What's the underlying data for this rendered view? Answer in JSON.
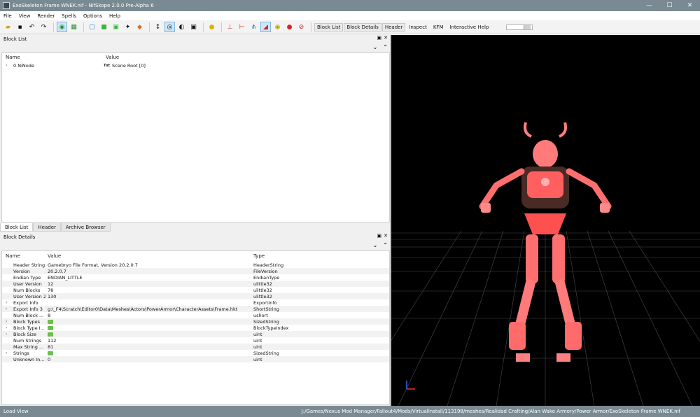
{
  "window": {
    "title": "ExoSkeleton Frame WNEK.nif - NifSkope 2.0.0 Pre-Alpha 6",
    "minimize": "—",
    "maximize": "☐",
    "close": "✕"
  },
  "menu": [
    "File",
    "View",
    "Render",
    "Spells",
    "Options",
    "Help"
  ],
  "toolbar": {
    "buttons": [
      "Block List",
      "Block Details",
      "Header",
      "Inspect",
      "KFM",
      "Interactive Help"
    ]
  },
  "block_list": {
    "title": "Block List",
    "columns": [
      "Name",
      "Value"
    ],
    "rows": [
      {
        "name": "0 NiNode",
        "value": "Scene Root [0]",
        "value_icon": "Txt"
      }
    ]
  },
  "tabs": [
    "Block List",
    "Header",
    "Archive Browser"
  ],
  "block_details": {
    "title": "Block Details",
    "columns": [
      "Name",
      "Value",
      "Type"
    ],
    "rows": [
      {
        "name": "Header String",
        "value": "Gamebryo File Format, Version 20.2.0.7",
        "type": "HeaderString"
      },
      {
        "name": "Version",
        "value": "20.2.0.7",
        "type": "FileVersion"
      },
      {
        "name": "Endian Type",
        "value": "ENDIAN_LITTLE",
        "type": "EndianType"
      },
      {
        "name": "User Version",
        "value": "12",
        "type": "ulittle32"
      },
      {
        "name": "Num Blocks",
        "value": "78",
        "type": "ulittle32"
      },
      {
        "name": "User Version 2",
        "value": "130",
        "type": "ulittle32"
      },
      {
        "name": "Export Info",
        "value": "",
        "type": "ExportInfo"
      },
      {
        "name": "Export Info 3",
        "value": "g:\\_F4\\Scratch\\Editor0\\Data\\Meshes\\Actors\\PowerArmor\\CharacterAssets\\Frame.hkt",
        "type": "ShortString"
      },
      {
        "name": "Num Block ...",
        "value": "8",
        "type": "ushort"
      },
      {
        "name": "Block Types",
        "value": "",
        "type": "SizedString"
      },
      {
        "name": "Block Type I...",
        "value": "",
        "type": "BlockTypeIndex"
      },
      {
        "name": "Block Size",
        "value": "",
        "type": "uint"
      },
      {
        "name": "Num Strings",
        "value": "112",
        "type": "uint"
      },
      {
        "name": "Max String ...",
        "value": "81",
        "type": "uint"
      },
      {
        "name": "Strings",
        "value": "",
        "type": "SizedString"
      },
      {
        "name": "Unknown In...",
        "value": "0",
        "type": "uint"
      }
    ]
  },
  "status": {
    "left": "Load View",
    "path": "J:/Games/Nexus Mod Manager/Fallout4/Mods/VirtualInstall/113198/meshes/Realidad Crafting/Alan Wake Armory/Power Armor/ExoSkeleton Frame WNEK.nif"
  }
}
